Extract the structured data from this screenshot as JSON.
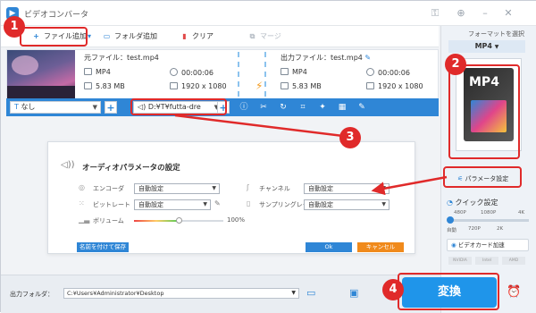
{
  "app": {
    "title": "ビデオコンバータ"
  },
  "toolbar": {
    "add_file": "ファイル追加",
    "add_folder": "フォルダ追加",
    "clear": "クリア",
    "merge": "マージ"
  },
  "file": {
    "source_label": "元ファイル：test.mp4",
    "output_label": "出力ファイル：test.mp4",
    "src_format": "MP4",
    "src_duration": "00:00:06",
    "src_size": "5.83 MB",
    "src_resolution": "1920 x 1080",
    "out_format": "MP4",
    "out_duration": "00:00:06",
    "out_size": "5.83 MB",
    "out_resolution": "1920 x 1080"
  },
  "bar": {
    "subtitle_value": "なし",
    "audio_value": "D:¥T¥futta-dre"
  },
  "audio_panel": {
    "title": "オーディオパラメータの設定",
    "encoder_label": "エンコーダ",
    "encoder_value": "自動設定",
    "bitrate_label": "ビットレート",
    "bitrate_value": "自動設定",
    "volume_label": "ボリューム",
    "volume_value": "100%",
    "volume_level_fraction": 0.5,
    "channel_label": "チャンネル",
    "channel_value": "自動設定",
    "samplerate_label": "サンプリングレート",
    "samplerate_value": "自動設定",
    "save_as_button": "名前を付けて保存",
    "ok_button": "Ok",
    "cancel_button": "キャンセル"
  },
  "right_panel": {
    "output_format_header": "フォーマットを選択",
    "format_value": "MP4",
    "format_tile_label": "MP4",
    "param_settings": "パラメータ設定",
    "quick_settings": "クイック設定",
    "quality_labels_top": [
      "480P",
      "1080P",
      "4K"
    ],
    "quality_labels_bottom": [
      "自動",
      "720P",
      "2K"
    ],
    "gpu_accel": "ビデオカード加速",
    "gpu_chips": [
      "NVIDIA",
      "Intel",
      "AMD"
    ]
  },
  "bottom": {
    "output_folder_label": "出力フォルダ：",
    "output_folder_value": "C:¥Users¥Administrator¥Desktop",
    "convert_button": "変換"
  },
  "annotations": {
    "step1": "1",
    "step2": "2",
    "step3": "3",
    "step4": "4"
  },
  "colors": {
    "accent": "#2f86d6",
    "annotation_red": "#e02a2a",
    "orange": "#f08a1c",
    "convert_blue": "#1f95ea"
  }
}
